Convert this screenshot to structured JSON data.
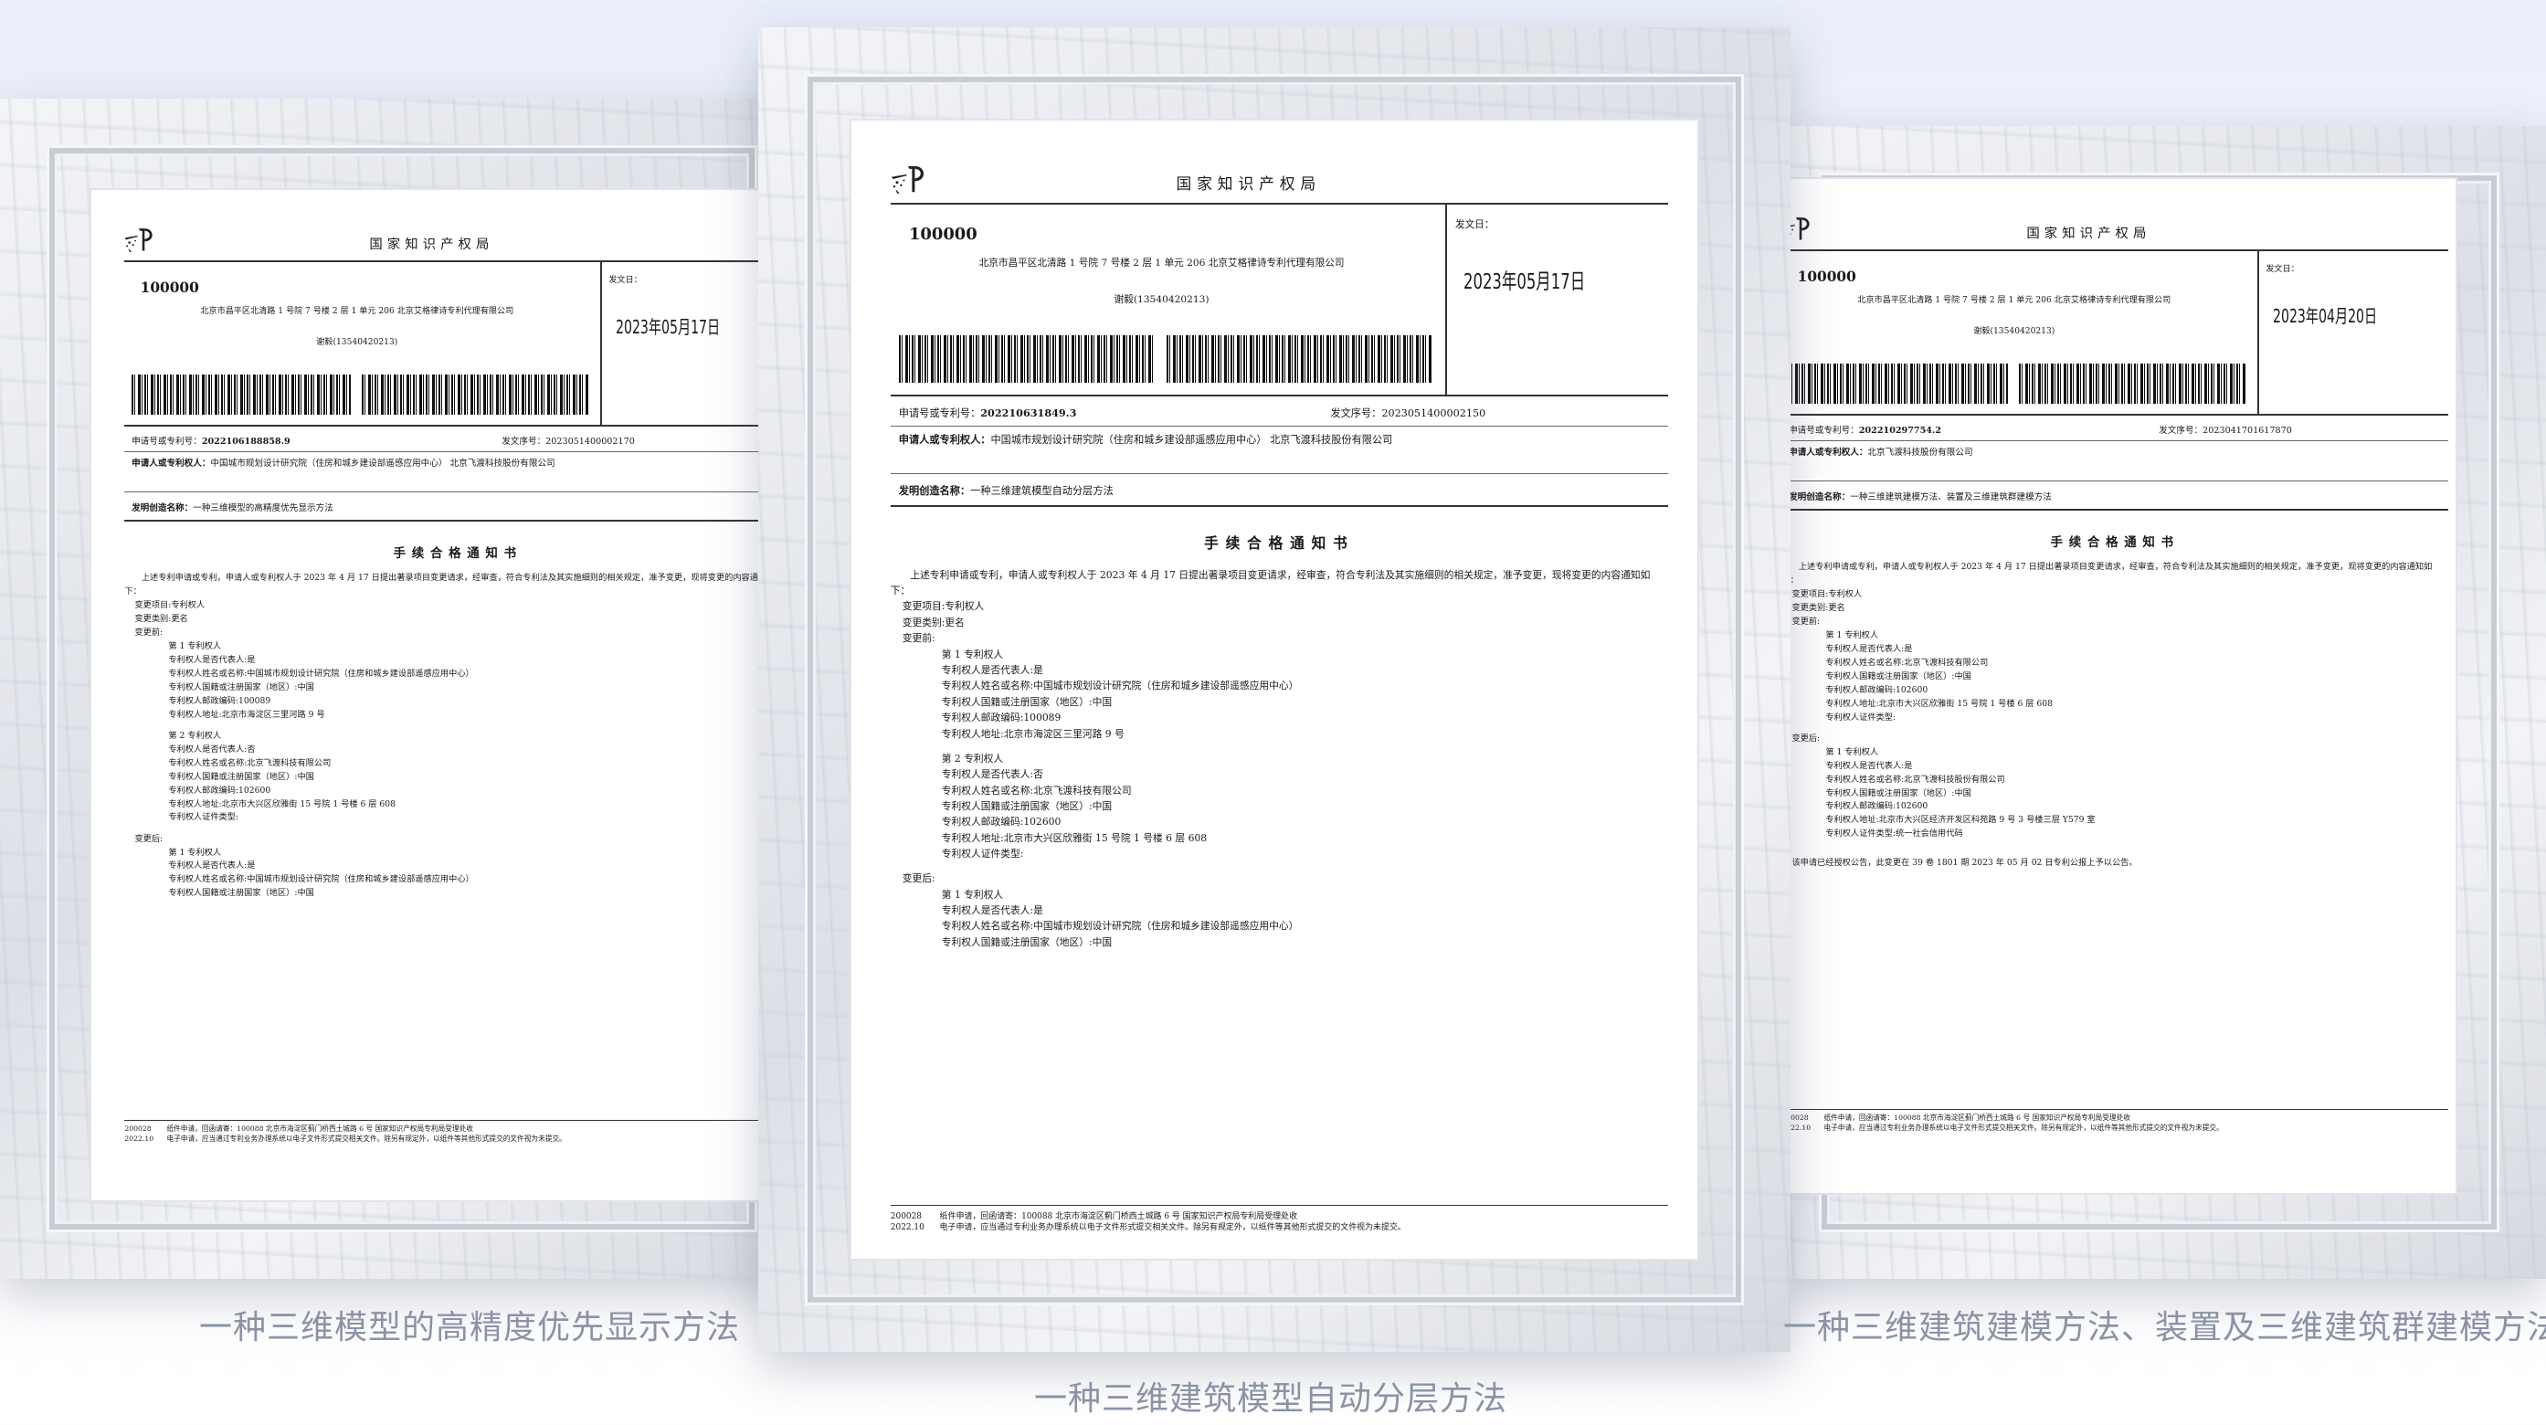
{
  "captions": {
    "left": "一种三维模型的高精度优先显示方法",
    "center": "一种三维建筑模型自动分层方法",
    "right": "一种三维建筑建模方法、装置及三维建筑群建模方法"
  },
  "common": {
    "office": "国家知识产权局",
    "postal_code": "100000",
    "address": "北京市昌平区北清路 1 号院 7 号楼 2 层 1 单元 206 北京艾格律诗专利代理有限公司",
    "addressee": "谢毅(13540420213)",
    "send_date_label": "发文日：",
    "app_no_label": "申请号或专利号：",
    "serial_label": "发文序号：",
    "applicant_label": "申请人或专利权人：",
    "invention_label": "发明创造名称：",
    "notice_title": "手续合格通知书",
    "intro": "上述专利申请或专利，申请人或专利权人于 2023 年 4 月 17 日提出著录项目变更请求，经审查，符合专利法及其实施细则的相关规定，准予变更，现将变更的内容通知如下：",
    "change_item": "变更项目:专利权人",
    "change_type": "变更类别:更名",
    "before": "变更前:",
    "after": "变更后:",
    "footer_code": "200028\n2022.10",
    "footer_text": "纸件申请，回函请寄：100088 北京市海淀区蓟门桥西土城路 6 号 国家知识产权局专利局受理处收\n电子申请，应当通过专利业务办理系统以电子文件形式提交相关文件。除另有规定外，以纸件等其他形式提交的文件视为未提交。"
  },
  "docs": {
    "left": {
      "date": "2023年05月17日",
      "app_no": "2022106188858.9",
      "serial": "2023051400002170",
      "applicant": "中国城市规划设计研究院（住房和城乡建设部遥感应用中心） 北京飞渡科技股份有限公司",
      "invention": "一种三维模型的高精度优先显示方法",
      "before_lines": [
        "第 1 专利权人",
        "专利权人是否代表人:是",
        "专利权人姓名或名称:中国城市规划设计研究院（住房和城乡建设部遥感应用中心）",
        "专利权人国籍或注册国家（地区）:中国",
        "专利权人邮政编码:100089",
        "专利权人地址:北京市海淀区三里河路 9 号",
        "",
        "第 2 专利权人",
        "专利权人是否代表人:否",
        "专利权人姓名或名称:北京飞渡科技有限公司",
        "专利权人国籍或注册国家（地区）:中国",
        "专利权人邮政编码:102600",
        "专利权人地址:北京市大兴区欣雅街 15 号院 1 号楼 6 层 608",
        "专利权人证件类型:"
      ],
      "after_lines": [
        "第 1 专利权人",
        "专利权人是否代表人:是",
        "专利权人姓名或名称:中国城市规划设计研究院（住房和城乡建设部遥感应用中心）",
        "专利权人国籍或注册国家（地区）:中国"
      ]
    },
    "center": {
      "date": "2023年05月17日",
      "app_no": "202210631849.3",
      "serial": "2023051400002150",
      "applicant": "中国城市规划设计研究院（住房和城乡建设部遥感应用中心） 北京飞渡科技股份有限公司",
      "invention": "一种三维建筑模型自动分层方法",
      "before_lines": [
        "第 1 专利权人",
        "专利权人是否代表人:是",
        "专利权人姓名或名称:中国城市规划设计研究院（住房和城乡建设部遥感应用中心）",
        "专利权人国籍或注册国家（地区）:中国",
        "专利权人邮政编码:100089",
        "专利权人地址:北京市海淀区三里河路 9 号",
        "",
        "第 2 专利权人",
        "专利权人是否代表人:否",
        "专利权人姓名或名称:北京飞渡科技有限公司",
        "专利权人国籍或注册国家（地区）:中国",
        "专利权人邮政编码:102600",
        "专利权人地址:北京市大兴区欣雅街 15 号院 1 号楼 6 层 608",
        "专利权人证件类型:"
      ],
      "after_lines": [
        "第 1 专利权人",
        "专利权人是否代表人:是",
        "专利权人姓名或名称:中国城市规划设计研究院（住房和城乡建设部遥感应用中心）",
        "专利权人国籍或注册国家（地区）:中国"
      ]
    },
    "right": {
      "date": "2023年04月20日",
      "app_no": "202210297754.2",
      "serial": "2023041701617870",
      "applicant": "北京飞渡科技股份有限公司",
      "invention": "一种三维建筑建模方法、装置及三维建筑群建模方法",
      "before_lines": [
        "第 1 专利权人",
        "专利权人是否代表人:是",
        "专利权人姓名或名称:北京飞渡科技有限公司",
        "专利权人国籍或注册国家（地区）:中国",
        "专利权人邮政编码:102600",
        "专利权人地址:北京市大兴区欣雅街 15 号院 1 号楼 6 层 608",
        "专利权人证件类型:"
      ],
      "after_lines": [
        "第 1 专利权人",
        "专利权人是否代表人:是",
        "专利权人姓名或名称:北京飞渡科技股份有限公司",
        "专利权人国籍或注册国家（地区）:中国",
        "专利权人邮政编码:102600",
        "专利权人地址:北京市大兴区经济开发区科苑路 9 号 3 号楼三层 Y579 室",
        "专利权人证件类型:统一社会信用代码"
      ],
      "closing": "该申请已经授权公告，此变更在 39 卷 1801 期 2023 年 05 月 02 日专利公报上予以公告。"
    }
  }
}
